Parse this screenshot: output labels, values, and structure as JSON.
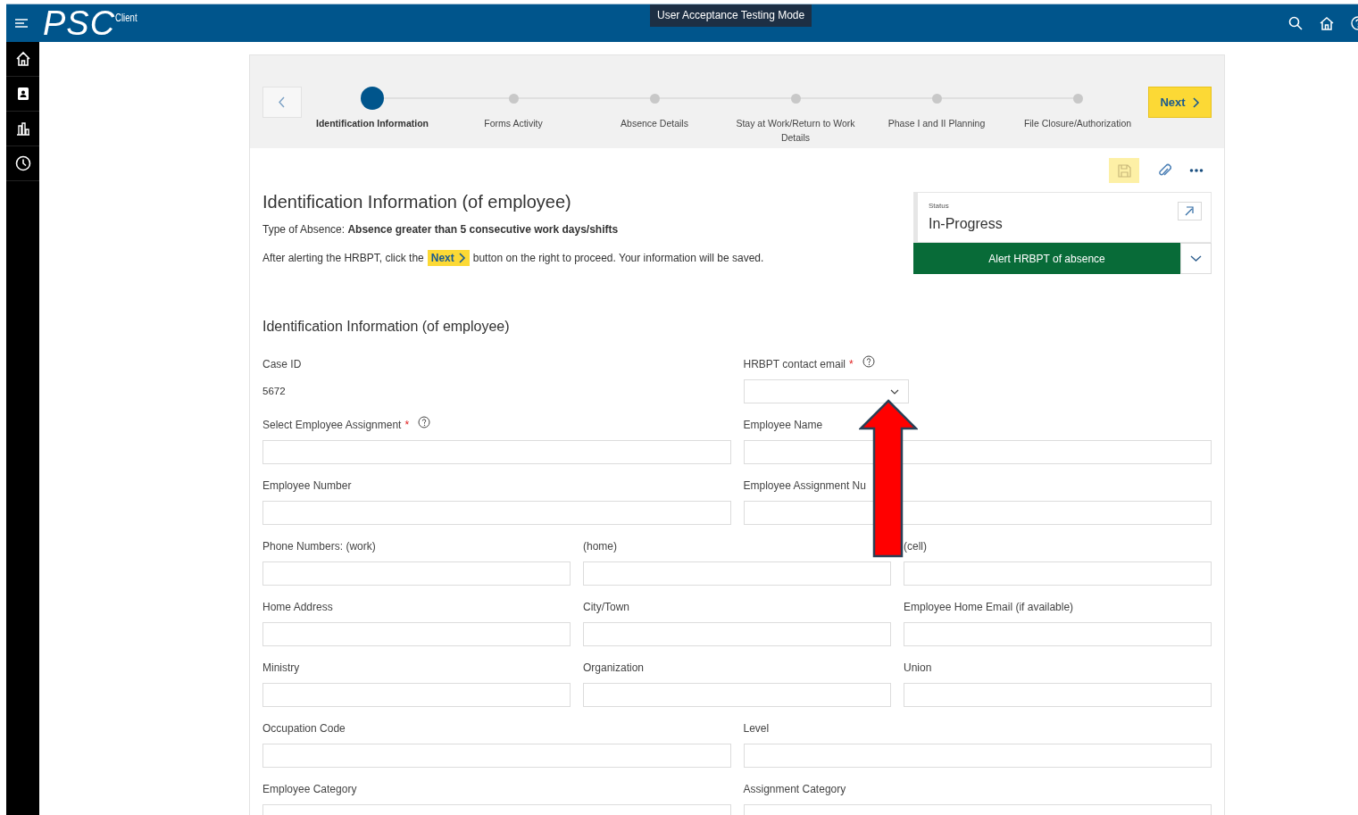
{
  "topbar": {
    "logo": "PSC",
    "logo_suffix": "Client",
    "mode_badge": "User Acceptance Testing Mode"
  },
  "stepper": {
    "steps": [
      {
        "label": "Identification Information",
        "selected": true
      },
      {
        "label": "Forms Activity",
        "selected": false
      },
      {
        "label": "Absence Details",
        "selected": false
      },
      {
        "label": "Stay at Work/Return to Work Details",
        "selected": false
      },
      {
        "label": "Phase I and II Planning",
        "selected": false
      },
      {
        "label": "File Closure/Authorization",
        "selected": false
      }
    ],
    "next_button": "Next"
  },
  "header": {
    "title": "Identification Information (of employee)",
    "absence_type": "Type of Absence: **Absence greater than 5 consecutive work days/shifts**",
    "instruction": {
      "before": "After alerting the HRBPT, click the",
      "chip": "Next",
      "after": "button on the right to proceed. Your information will be saved."
    }
  },
  "status": {
    "label": "Status",
    "value": "In-Progress",
    "action": "Alert HRBPT of absence"
  },
  "section": {
    "title": "Identification Information (of employee)",
    "rows": [
      [
        {
          "kind": "static",
          "label": "Case ID",
          "value": "5672"
        },
        {
          "kind": "select",
          "label": "HRBPT contact email",
          "required_mark": "*",
          "help": true
        }
      ],
      [
        {
          "kind": "text",
          "label": "Select Employee Assignment",
          "required_mark": "*",
          "help": true
        },
        {
          "kind": "text",
          "label": "Employee Name"
        }
      ],
      [
        {
          "kind": "text",
          "label": "Employee Number"
        },
        {
          "kind": "text",
          "label": "Employee Assignment Nu"
        }
      ],
      [
        {
          "kind": "text",
          "label": "Phone Numbers: (work)"
        },
        {
          "kind": "text",
          "label": "(home)"
        },
        {
          "kind": "text",
          "label": "(cell)"
        }
      ],
      [
        {
          "kind": "text",
          "label": "Home Address"
        },
        {
          "kind": "text",
          "label": "City/Town"
        },
        {
          "kind": "text",
          "label": "Employee Home Email (if available)"
        }
      ],
      [
        {
          "kind": "text",
          "label": "Ministry"
        },
        {
          "kind": "text",
          "label": "Organization"
        },
        {
          "kind": "text",
          "label": "Union"
        }
      ],
      [
        {
          "kind": "text",
          "label": "Occupation Code"
        },
        {
          "kind": "text",
          "label": "Level"
        }
      ],
      [
        {
          "kind": "text",
          "label": "Employee Category"
        },
        {
          "kind": "text",
          "label": "Assignment Category"
        }
      ]
    ]
  }
}
